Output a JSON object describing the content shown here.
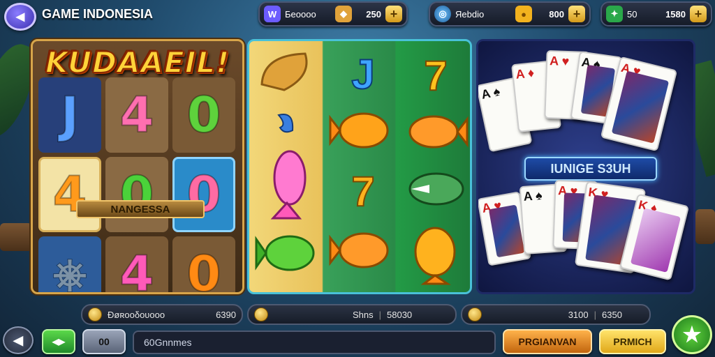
{
  "header": {
    "back_label": "◀",
    "title": "GAME INDONESIA"
  },
  "currency": [
    {
      "icon": "purple-gem-icon",
      "label": "Бeoooo",
      "value": "250",
      "plus": "+"
    },
    {
      "icon": "globe-icon",
      "label": "Яebdio",
      "value": "800",
      "plus": "+"
    },
    {
      "icon": "green-gem-icon",
      "label": "50",
      "value": "1580",
      "plus": "+"
    }
  ],
  "left_game": {
    "logo": "KUDAAEIL!",
    "banner": "NANGESSA",
    "cells": [
      "J",
      "4",
      "0",
      "4",
      "0",
      "0",
      "",
      "4",
      "0"
    ]
  },
  "middle_game": {
    "symbols": [
      "J",
      "7",
      "7",
      "7"
    ]
  },
  "right_game": {
    "label": "IUNIGE S3UH",
    "card_ranks": [
      "A",
      "A",
      "A",
      "A",
      "A",
      "A",
      "A",
      "A",
      "K",
      "K"
    ]
  },
  "info_bar": [
    {
      "label": "Ðøʀooδουooo",
      "value": "6390"
    },
    {
      "label": "Shns",
      "value": "58030"
    },
    {
      "label": "3100",
      "value": "6350"
    }
  ],
  "bottom": {
    "left_arrow": "◀",
    "green_btn": "◀▶",
    "count": "00",
    "chat_placeholder": "60Gnnmes",
    "orange_btn": "PRGIANVAN",
    "yellow_btn": "PRMICH",
    "star": "★"
  },
  "colors": {
    "accent_gold": "#ffd339",
    "accent_green": "#2aa84a",
    "accent_purple": "#6c5cff"
  }
}
